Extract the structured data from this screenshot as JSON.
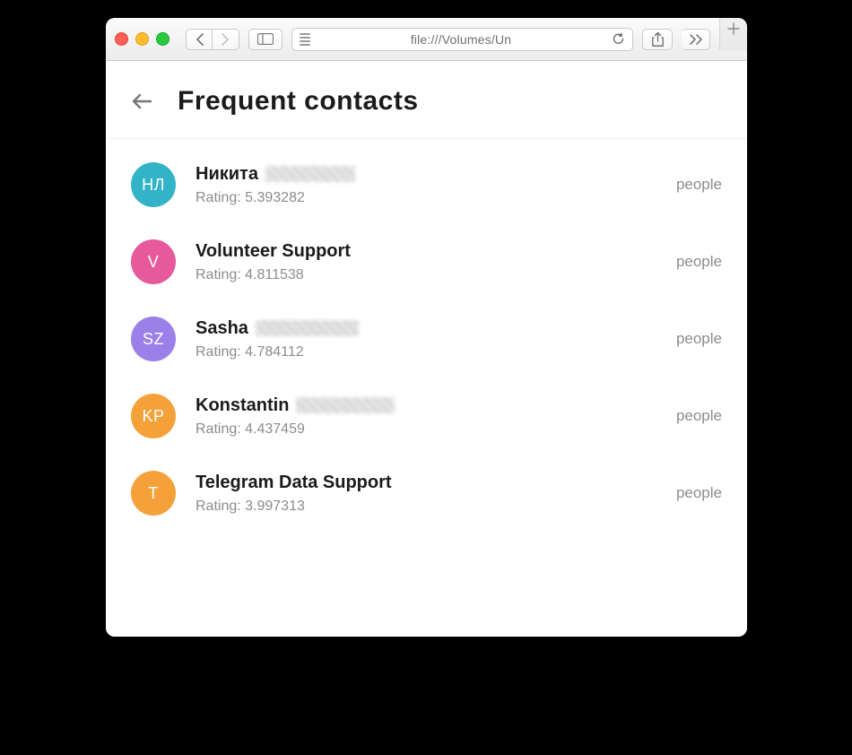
{
  "browser": {
    "url_display": "file:///Volumes/Un"
  },
  "header": {
    "title": "Frequent contacts"
  },
  "labels": {
    "rating_prefix": "Rating: "
  },
  "contacts": [
    {
      "initials": "НЛ",
      "avatar_color": "#32b3c7",
      "first_name": "Никита",
      "surname_redacted": true,
      "redact_width": 100,
      "rating": "5.393282",
      "tag": "people"
    },
    {
      "initials": "V",
      "avatar_color": "#e65a9c",
      "first_name": "Volunteer Support",
      "surname_redacted": false,
      "rating": "4.811538",
      "tag": "people"
    },
    {
      "initials": "SZ",
      "avatar_color": "#9a80e8",
      "first_name": "Sasha",
      "surname_redacted": true,
      "redact_width": 115,
      "rating": "4.784112",
      "tag": "people"
    },
    {
      "initials": "KP",
      "avatar_color": "#f5a13a",
      "first_name": "Konstantin",
      "surname_redacted": true,
      "redact_width": 110,
      "rating": "4.437459",
      "tag": "people"
    },
    {
      "initials": "T",
      "avatar_color": "#f5a13a",
      "first_name": "Telegram Data Support",
      "surname_redacted": false,
      "rating": "3.997313",
      "tag": "people"
    }
  ]
}
